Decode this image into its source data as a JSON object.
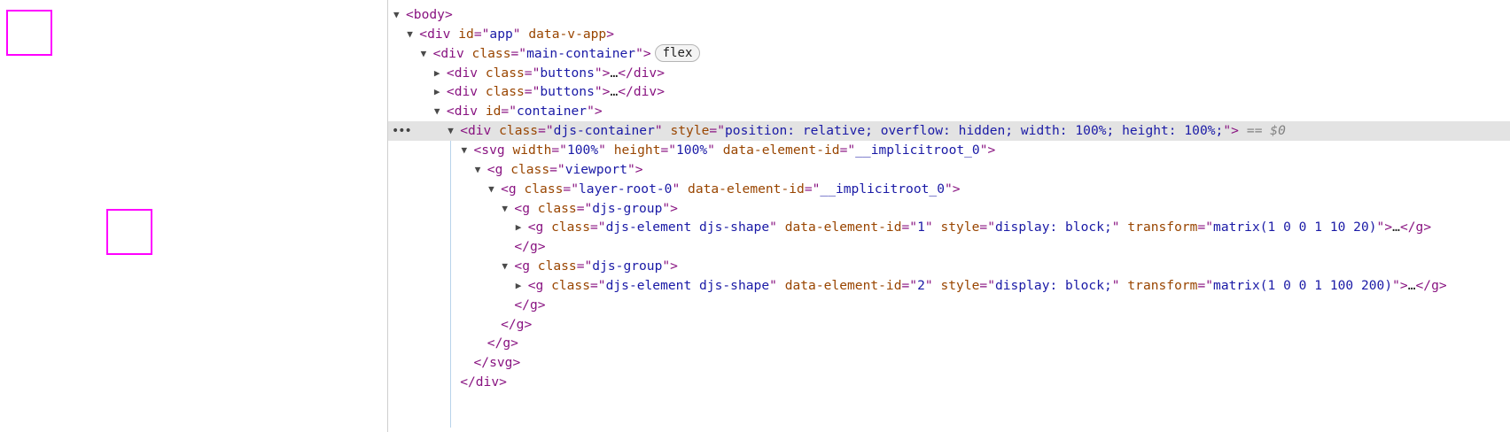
{
  "canvas": {
    "shapes": [
      {
        "id": "1",
        "stroke": "#ff00ff"
      },
      {
        "id": "2",
        "stroke": "#ff00ff"
      }
    ]
  },
  "devtools": {
    "selected_suffix": "== $0",
    "more_button": "•••",
    "flex_badge": "flex",
    "rows": [
      {
        "depth": 0,
        "tri": "open",
        "parts": [
          [
            "p",
            "<"
          ],
          [
            "t",
            "body"
          ],
          [
            "p",
            ">"
          ]
        ]
      },
      {
        "depth": 1,
        "tri": "open",
        "parts": [
          [
            "p",
            "<"
          ],
          [
            "t",
            "div"
          ],
          [
            "s",
            " "
          ],
          [
            "n",
            "id"
          ],
          [
            "p",
            "=\""
          ],
          [
            "v",
            "app"
          ],
          [
            "p",
            "\""
          ],
          [
            "s",
            " "
          ],
          [
            "n",
            "data-v-app"
          ],
          [
            "p",
            ">"
          ]
        ]
      },
      {
        "depth": 2,
        "tri": "open",
        "parts": [
          [
            "p",
            "<"
          ],
          [
            "t",
            "div"
          ],
          [
            "s",
            " "
          ],
          [
            "n",
            "class"
          ],
          [
            "p",
            "=\""
          ],
          [
            "v",
            "main-container"
          ],
          [
            "p",
            "\""
          ],
          [
            "p",
            ">"
          ]
        ],
        "badge": true
      },
      {
        "depth": 3,
        "tri": "closed",
        "parts": [
          [
            "p",
            "<"
          ],
          [
            "t",
            "div"
          ],
          [
            "s",
            " "
          ],
          [
            "n",
            "class"
          ],
          [
            "p",
            "=\""
          ],
          [
            "v",
            "buttons"
          ],
          [
            "p",
            "\""
          ],
          [
            "p",
            ">"
          ],
          [
            "e",
            "…"
          ],
          [
            "p",
            "</"
          ],
          [
            "t",
            "div"
          ],
          [
            "p",
            ">"
          ]
        ]
      },
      {
        "depth": 3,
        "tri": "closed",
        "parts": [
          [
            "p",
            "<"
          ],
          [
            "t",
            "div"
          ],
          [
            "s",
            " "
          ],
          [
            "n",
            "class"
          ],
          [
            "p",
            "=\""
          ],
          [
            "v",
            "buttons"
          ],
          [
            "p",
            "\""
          ],
          [
            "p",
            ">"
          ],
          [
            "e",
            "…"
          ],
          [
            "p",
            "</"
          ],
          [
            "t",
            "div"
          ],
          [
            "p",
            ">"
          ]
        ]
      },
      {
        "depth": 3,
        "tri": "open",
        "parts": [
          [
            "p",
            "<"
          ],
          [
            "t",
            "div"
          ],
          [
            "s",
            " "
          ],
          [
            "n",
            "id"
          ],
          [
            "p",
            "=\""
          ],
          [
            "v",
            "container"
          ],
          [
            "p",
            "\""
          ],
          [
            "p",
            ">"
          ]
        ]
      },
      {
        "depth": 4,
        "tri": "open",
        "selected": true,
        "parts": [
          [
            "p",
            "<"
          ],
          [
            "t",
            "div"
          ],
          [
            "s",
            " "
          ],
          [
            "n",
            "class"
          ],
          [
            "p",
            "=\""
          ],
          [
            "v",
            "djs-container"
          ],
          [
            "p",
            "\""
          ],
          [
            "s",
            " "
          ],
          [
            "n",
            "style"
          ],
          [
            "p",
            "=\""
          ],
          [
            "v",
            "position: relative; overflow: hidden; width: 100%; height: 100%;"
          ],
          [
            "p",
            "\""
          ],
          [
            "p",
            ">"
          ]
        ]
      },
      {
        "depth": 5,
        "tri": "open",
        "parts": [
          [
            "p",
            "<"
          ],
          [
            "t",
            "svg"
          ],
          [
            "s",
            " "
          ],
          [
            "n",
            "width"
          ],
          [
            "p",
            "=\""
          ],
          [
            "v",
            "100%"
          ],
          [
            "p",
            "\""
          ],
          [
            "s",
            " "
          ],
          [
            "n",
            "height"
          ],
          [
            "p",
            "=\""
          ],
          [
            "v",
            "100%"
          ],
          [
            "p",
            "\""
          ],
          [
            "s",
            " "
          ],
          [
            "n",
            "data-element-id"
          ],
          [
            "p",
            "=\""
          ],
          [
            "v",
            "__implicitroot_0"
          ],
          [
            "p",
            "\""
          ],
          [
            "p",
            ">"
          ]
        ]
      },
      {
        "depth": 6,
        "tri": "open",
        "parts": [
          [
            "p",
            "<"
          ],
          [
            "t",
            "g"
          ],
          [
            "s",
            " "
          ],
          [
            "n",
            "class"
          ],
          [
            "p",
            "=\""
          ],
          [
            "v",
            "viewport"
          ],
          [
            "p",
            "\""
          ],
          [
            "p",
            ">"
          ]
        ]
      },
      {
        "depth": 7,
        "tri": "open",
        "parts": [
          [
            "p",
            "<"
          ],
          [
            "t",
            "g"
          ],
          [
            "s",
            " "
          ],
          [
            "n",
            "class"
          ],
          [
            "p",
            "=\""
          ],
          [
            "v",
            "layer-root-0"
          ],
          [
            "p",
            "\""
          ],
          [
            "s",
            " "
          ],
          [
            "n",
            "data-element-id"
          ],
          [
            "p",
            "=\""
          ],
          [
            "v",
            "__implicitroot_0"
          ],
          [
            "p",
            "\""
          ],
          [
            "p",
            ">"
          ]
        ]
      },
      {
        "depth": 8,
        "tri": "open",
        "parts": [
          [
            "p",
            "<"
          ],
          [
            "t",
            "g"
          ],
          [
            "s",
            " "
          ],
          [
            "n",
            "class"
          ],
          [
            "p",
            "=\""
          ],
          [
            "v",
            "djs-group"
          ],
          [
            "p",
            "\""
          ],
          [
            "p",
            ">"
          ]
        ]
      },
      {
        "depth": 9,
        "tri": "closed",
        "parts": [
          [
            "p",
            "<"
          ],
          [
            "t",
            "g"
          ],
          [
            "s",
            " "
          ],
          [
            "n",
            "class"
          ],
          [
            "p",
            "=\""
          ],
          [
            "v",
            "djs-element djs-shape"
          ],
          [
            "p",
            "\""
          ],
          [
            "s",
            " "
          ],
          [
            "n",
            "data-element-id"
          ],
          [
            "p",
            "=\""
          ],
          [
            "v",
            "1"
          ],
          [
            "p",
            "\""
          ],
          [
            "s",
            " "
          ],
          [
            "n",
            "style"
          ],
          [
            "p",
            "=\""
          ],
          [
            "v",
            "display: block;"
          ],
          [
            "p",
            "\""
          ],
          [
            "s",
            " "
          ],
          [
            "n",
            "transform"
          ],
          [
            "p",
            "=\""
          ],
          [
            "v",
            "matrix(1 0 0 1 10 20)"
          ],
          [
            "p",
            "\""
          ],
          [
            "p",
            ">"
          ],
          [
            "e",
            "…"
          ],
          [
            "p",
            "</"
          ],
          [
            "t",
            "g"
          ],
          [
            "p",
            ">"
          ]
        ]
      },
      {
        "depth": 8,
        "tri": "none",
        "parts": [
          [
            "p",
            "</"
          ],
          [
            "t",
            "g"
          ],
          [
            "p",
            ">"
          ]
        ]
      },
      {
        "depth": 8,
        "tri": "open",
        "parts": [
          [
            "p",
            "<"
          ],
          [
            "t",
            "g"
          ],
          [
            "s",
            " "
          ],
          [
            "n",
            "class"
          ],
          [
            "p",
            "=\""
          ],
          [
            "v",
            "djs-group"
          ],
          [
            "p",
            "\""
          ],
          [
            "p",
            ">"
          ]
        ]
      },
      {
        "depth": 9,
        "tri": "closed",
        "parts": [
          [
            "p",
            "<"
          ],
          [
            "t",
            "g"
          ],
          [
            "s",
            " "
          ],
          [
            "n",
            "class"
          ],
          [
            "p",
            "=\""
          ],
          [
            "v",
            "djs-element djs-shape"
          ],
          [
            "p",
            "\""
          ],
          [
            "s",
            " "
          ],
          [
            "n",
            "data-element-id"
          ],
          [
            "p",
            "=\""
          ],
          [
            "v",
            "2"
          ],
          [
            "p",
            "\""
          ],
          [
            "s",
            " "
          ],
          [
            "n",
            "style"
          ],
          [
            "p",
            "=\""
          ],
          [
            "v",
            "display: block;"
          ],
          [
            "p",
            "\""
          ],
          [
            "s",
            " "
          ],
          [
            "n",
            "transform"
          ],
          [
            "p",
            "=\""
          ],
          [
            "v",
            "matrix(1 0 0 1 100 200)"
          ],
          [
            "p",
            "\""
          ],
          [
            "p",
            ">"
          ],
          [
            "e",
            "…"
          ],
          [
            "p",
            "</"
          ],
          [
            "t",
            "g"
          ],
          [
            "p",
            ">"
          ]
        ]
      },
      {
        "depth": 8,
        "tri": "none",
        "parts": [
          [
            "p",
            "</"
          ],
          [
            "t",
            "g"
          ],
          [
            "p",
            ">"
          ]
        ]
      },
      {
        "depth": 7,
        "tri": "none",
        "parts": [
          [
            "p",
            "</"
          ],
          [
            "t",
            "g"
          ],
          [
            "p",
            ">"
          ]
        ]
      },
      {
        "depth": 6,
        "tri": "none",
        "parts": [
          [
            "p",
            "</"
          ],
          [
            "t",
            "g"
          ],
          [
            "p",
            ">"
          ]
        ]
      },
      {
        "depth": 5,
        "tri": "none",
        "parts": [
          [
            "p",
            "</"
          ],
          [
            "t",
            "svg"
          ],
          [
            "p",
            ">"
          ]
        ]
      },
      {
        "depth": 4,
        "tri": "none",
        "parts": [
          [
            "p",
            "</"
          ],
          [
            "t",
            "div"
          ],
          [
            "p",
            ">"
          ]
        ]
      }
    ]
  }
}
